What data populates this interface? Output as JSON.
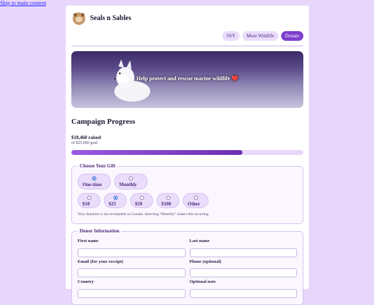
{
  "skip_link": "Skip to main content",
  "site": {
    "title": "Seals n Sables"
  },
  "nav": {
    "items": [
      "SSY",
      "More Wildlife",
      "Donate"
    ]
  },
  "hero": {
    "caption": "Help protect and rescue marine wildlife",
    "heart": "❤️"
  },
  "campaign": {
    "heading": "Campaign Progress",
    "raised": "$18,460 raised",
    "goal": "of $25,000 goal",
    "progress_fraction": 0.7384
  },
  "gift": {
    "legend": "Choose Your Gift",
    "frequencies": [
      {
        "label": "One-time",
        "selected": true
      },
      {
        "label": "Monthly",
        "selected": false
      }
    ],
    "amounts": [
      {
        "label": "$10",
        "selected": false
      },
      {
        "label": "$25",
        "selected": true
      },
      {
        "label": "$50",
        "selected": false
      },
      {
        "label": "$100",
        "selected": false
      },
      {
        "label": "Other",
        "selected": false
      }
    ],
    "note": "Your donation is tax-receiptable in Canada. Selecting “Monthly” makes this recurring."
  },
  "donor": {
    "legend": "Donor Information",
    "fields": {
      "first_name": "First name",
      "last_name": "Last name",
      "email": "Email (for your receipt)",
      "phone": "Phone (optional)",
      "country": "Country",
      "note": "Optional note"
    }
  },
  "colors": {
    "accent": "#7d3fce",
    "background": "#e8d7fb"
  }
}
